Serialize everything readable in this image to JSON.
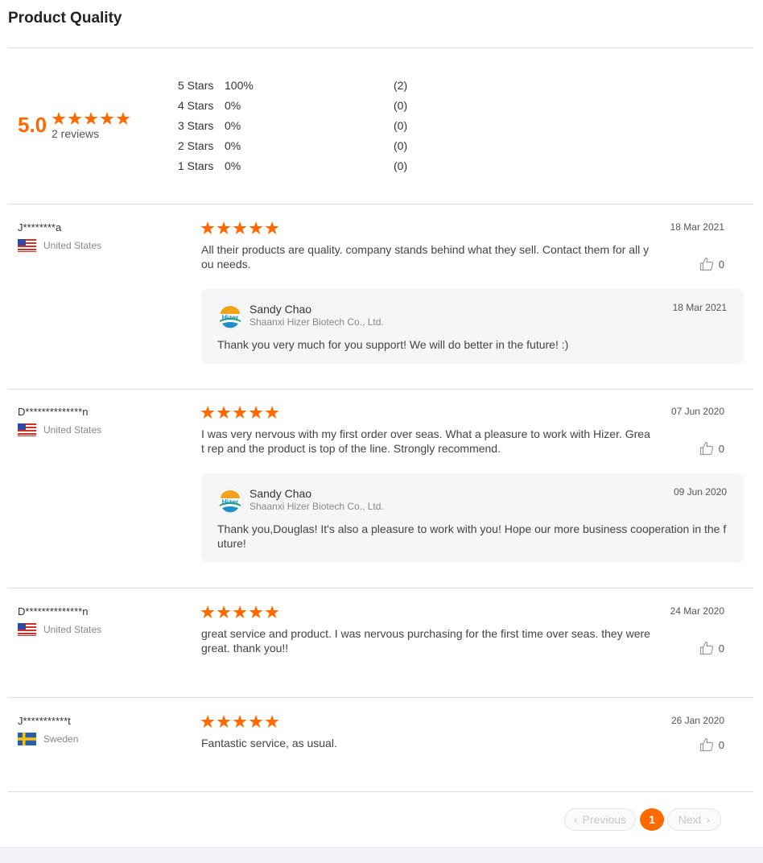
{
  "header": {
    "title": "Product Quality"
  },
  "summary": {
    "average": "5.0",
    "rating": 5,
    "max_rating": 5,
    "review_count": "2 reviews",
    "distribution": [
      {
        "label": "5  Stars",
        "percent": "100%",
        "count": "(2)"
      },
      {
        "label": "4  Stars",
        "percent": "0%",
        "count": "(0)"
      },
      {
        "label": "3  Stars",
        "percent": "0%",
        "count": "(0)"
      },
      {
        "label": "2  Stars",
        "percent": "0%",
        "count": "(0)"
      },
      {
        "label": "1  Stars",
        "percent": "0%",
        "count": "(0)"
      }
    ]
  },
  "reviews": [
    {
      "user": "J********a",
      "country": "United States",
      "flag_icon": "us-flag-icon",
      "rating": 5,
      "date": "18 Mar 2021",
      "text": "All their products are quality.  company stands behind what they sell.  Contact them for all you needs.",
      "likes": "0",
      "reply": {
        "name": "Sandy Chao",
        "company": "Shaanxi Hizer Biotech Co., Ltd.",
        "date": "18 Mar 2021",
        "text": "Thank you very much for you support! We will do better in the future! :)"
      }
    },
    {
      "user": "D**************n",
      "country": "United States",
      "flag_icon": "us-flag-icon",
      "rating": 5,
      "date": "07 Jun 2020",
      "text": "I was very nervous with my first order over seas.  What a pleasure to work with Hizer.  Great rep and the product is top of the line.  Strongly recommend.",
      "likes": "0",
      "reply": {
        "name": "Sandy Chao",
        "company": "Shaanxi Hizer Biotech Co., Ltd.",
        "date": "09 Jun 2020",
        "text": "Thank you,Douglas! It's also a pleasure to work with you! Hope our more business cooperation in the future!"
      }
    },
    {
      "user": "D**************n",
      "country": "United States",
      "flag_icon": "us-flag-icon",
      "rating": 5,
      "date": "24 Mar 2020",
      "text": "great service and product. I was nervous purchasing for the first time over seas.  they were great. thank you!!",
      "likes": "0"
    },
    {
      "user": "J***********t",
      "country": "Sweden",
      "flag_icon": "sweden-flag-icon",
      "rating": 5,
      "date": "26 Jan 2020",
      "text": "Fantastic service, as usual.",
      "likes": "0"
    }
  ],
  "pagination": {
    "previous": "Previous",
    "current": "1",
    "next": "Next"
  },
  "colors": {
    "accent": "#ff6a00",
    "reply_bg": "#f5f6f8",
    "divider": "#dcdcdc"
  },
  "reply_logo_text": "Hizer"
}
